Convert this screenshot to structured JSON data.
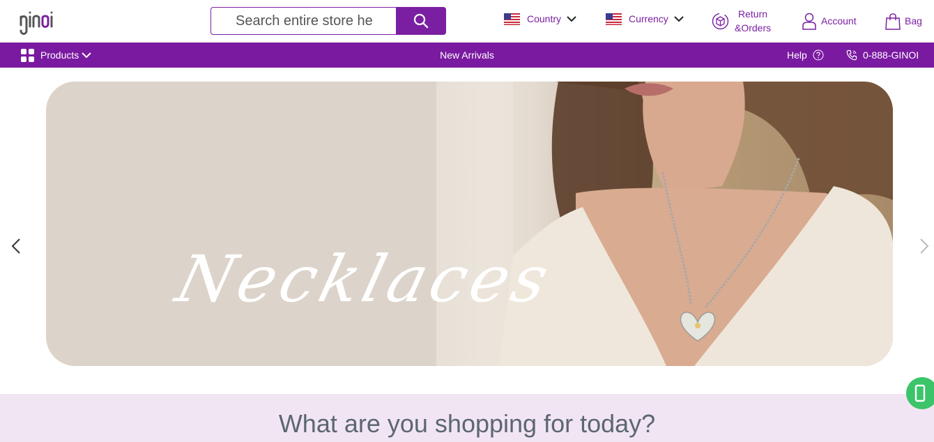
{
  "brand": {
    "logo_text": "ginoi",
    "accent_color": "#7a1fa2"
  },
  "search": {
    "placeholder": "Search entire store he"
  },
  "header": {
    "country_label": "Country",
    "currency_label": "Currency",
    "returns_line1": "Return",
    "returns_line2": "&Orders",
    "account_label": "Account",
    "bag_label": "Bag"
  },
  "nav": {
    "products_label": "Products",
    "new_arrivals_label": "New Arrivals",
    "help_label": "Help",
    "phone_label": "0-888-GINOI"
  },
  "hero": {
    "script_text": "Necklaces"
  },
  "section": {
    "title": "What are you shopping for today?"
  },
  "icons": [
    "logo",
    "search-icon",
    "us-flag-icon",
    "chevron-down-icon",
    "return-box-icon",
    "user-icon",
    "bag-icon",
    "grid-icon",
    "help-circle-icon",
    "phone-icon",
    "chevron-left-icon",
    "chevron-right-icon",
    "floating-action-icon"
  ]
}
